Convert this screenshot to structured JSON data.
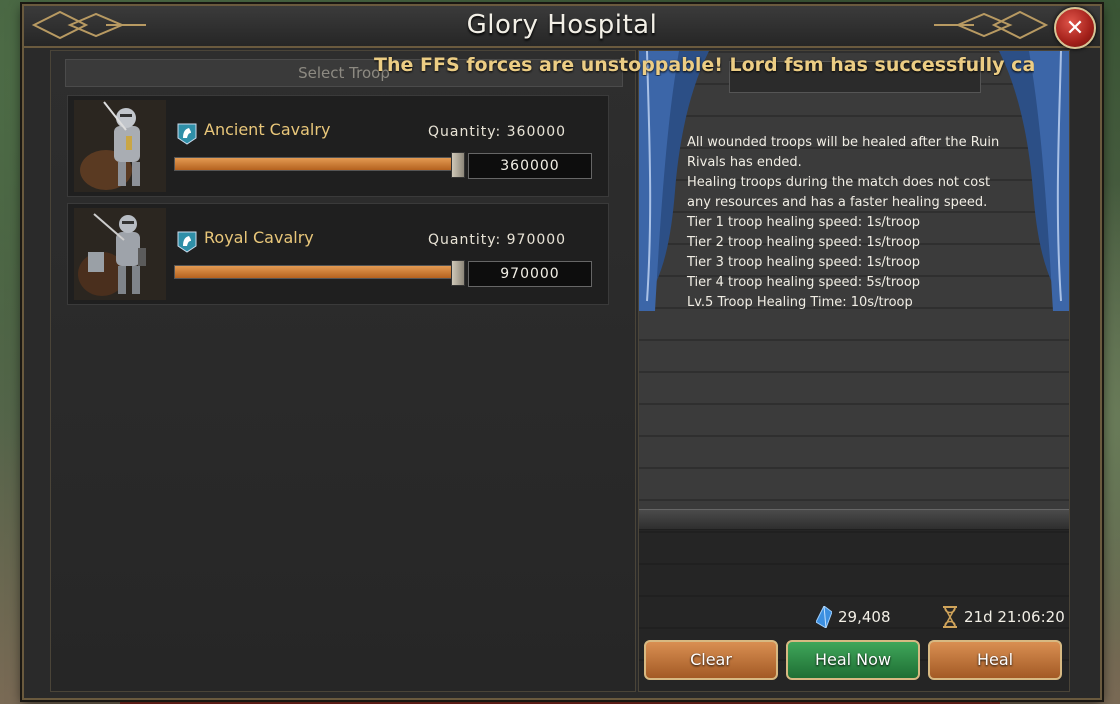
{
  "window": {
    "title": "Glory Hospital"
  },
  "ticker": "The FFS forces are unstoppable! Lord fsm has successfully captu",
  "left_panel": {
    "header": "Select Troop",
    "troops": [
      {
        "name": "Ancient Cavalry",
        "quantity_label": "Quantity: 360000",
        "input_value": "360000",
        "fill_fraction": 1.0
      },
      {
        "name": "Royal Cavalry",
        "quantity_label": "Quantity: 970000",
        "input_value": "970000",
        "fill_fraction": 1.0
      }
    ]
  },
  "rules": {
    "lines": [
      "All wounded troops will be healed after the Ruin",
      "Rivals has ended.",
      "Healing troops during the match does not cost",
      "any resources and has a faster healing speed.",
      "Tier 1 troop healing speed: 1s/troop",
      "Tier 2 troop healing speed: 1s/troop",
      "Tier 3 troop healing speed: 1s/troop",
      "Tier 4 troop healing speed: 5s/troop",
      "Lv.5 Troop Healing Time: 10s/troop"
    ]
  },
  "footer": {
    "gems": "29,408",
    "time": "21d 21:06:20",
    "clear_label": "Clear",
    "heal_now_label": "Heal Now",
    "heal_label": "Heal"
  },
  "colors": {
    "accent_gold": "#e9c77a",
    "slider_orange": "#d98f52",
    "heal_now_green": "#2f8a47",
    "close_red": "#b52a22"
  },
  "icons": [
    "close-icon",
    "cavalry-badge-icon",
    "gem-icon",
    "hourglass-icon"
  ]
}
